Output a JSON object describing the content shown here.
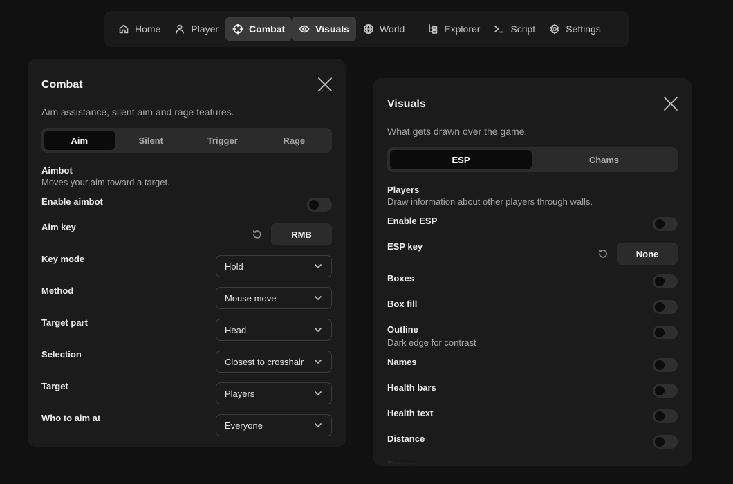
{
  "nav": {
    "items": [
      {
        "label": "Home",
        "icon": "home-icon"
      },
      {
        "label": "Player",
        "icon": "user-icon"
      },
      {
        "label": "Combat",
        "icon": "crosshair-icon"
      },
      {
        "label": "Visuals",
        "icon": "eye-icon"
      },
      {
        "label": "World",
        "icon": "globe-icon"
      },
      {
        "label": "Explorer",
        "icon": "tree-icon"
      },
      {
        "label": "Script",
        "icon": "terminal-icon"
      },
      {
        "label": "Settings",
        "icon": "gear-icon"
      }
    ],
    "active": [
      "Combat",
      "Visuals"
    ]
  },
  "combat": {
    "title": "Combat",
    "description": "Aim assistance, silent aim and rage features.",
    "tabs": [
      "Aim",
      "Silent",
      "Trigger",
      "Rage"
    ],
    "active_tab": "Aim",
    "section": {
      "title": "Aimbot",
      "subtitle": "Moves your aim toward a target."
    },
    "rows": {
      "enable_aimbot": {
        "label": "Enable aimbot",
        "enabled": false
      },
      "aim_key": {
        "label": "Aim key",
        "value": "RMB"
      },
      "key_mode": {
        "label": "Key mode",
        "value": "Hold"
      },
      "method": {
        "label": "Method",
        "value": "Mouse move"
      },
      "target_part": {
        "label": "Target part",
        "value": "Head"
      },
      "selection": {
        "label": "Selection",
        "value": "Closest to crosshair"
      },
      "target": {
        "label": "Target",
        "value": "Players"
      },
      "who_to_aim_at": {
        "label": "Who to aim at",
        "value": "Everyone"
      }
    }
  },
  "visuals": {
    "title": "Visuals",
    "description": "What gets drawn over the game.",
    "tabs": [
      "ESP",
      "Chams"
    ],
    "active_tab": "ESP",
    "section": {
      "title": "Players",
      "subtitle": "Draw information about other players through walls."
    },
    "rows": {
      "enable_esp": {
        "label": "Enable ESP",
        "enabled": false
      },
      "esp_key": {
        "label": "ESP key",
        "value": "None"
      },
      "boxes": {
        "label": "Boxes",
        "enabled": false
      },
      "box_fill": {
        "label": "Box fill",
        "enabled": false
      },
      "outline": {
        "label": "Outline",
        "subtitle": "Dark edge for contrast",
        "enabled": false
      },
      "names": {
        "label": "Names",
        "enabled": false
      },
      "health_bars": {
        "label": "Health bars",
        "enabled": false
      },
      "health_text": {
        "label": "Health text",
        "enabled": false
      },
      "distance": {
        "label": "Distance",
        "enabled": false
      },
      "tracers": {
        "label": "Tracers",
        "enabled": false
      }
    }
  }
}
